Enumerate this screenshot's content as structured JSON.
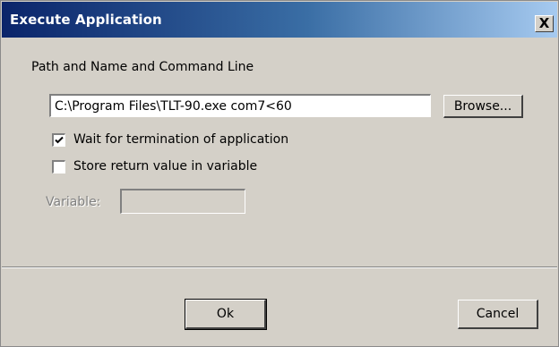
{
  "window": {
    "title": "Execute Application",
    "close_glyph": "X"
  },
  "path_section": {
    "label": "Path and Name and Command Line",
    "value": "C:\\Program Files\\TLT-90.exe com7<60",
    "browse_label": "Browse..."
  },
  "options": {
    "wait_label": "Wait for termination of application",
    "wait_checked": true,
    "store_label": "Store return value in variable",
    "store_checked": false
  },
  "variable": {
    "label": "Variable:",
    "value": ""
  },
  "footer": {
    "ok_label": "Ok",
    "cancel_label": "Cancel"
  }
}
